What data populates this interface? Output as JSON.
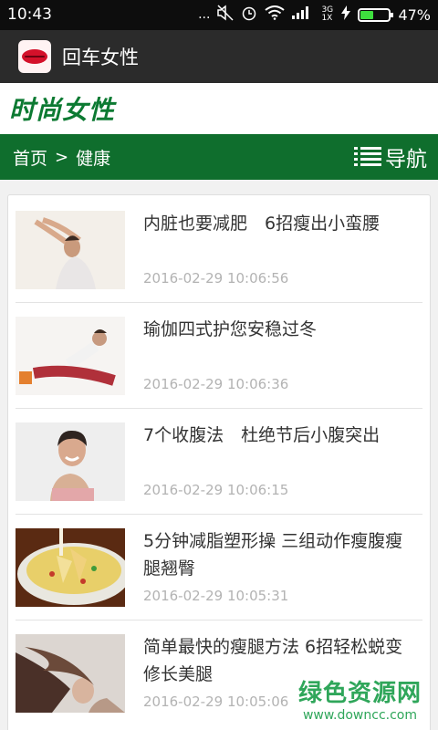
{
  "status_bar": {
    "time": "10:43",
    "dots": "...",
    "network": "3G 1X",
    "battery_percent": "47%",
    "battery_level": 0.47,
    "icons": [
      "mute-icon",
      "alarm-icon",
      "wifi-icon",
      "signal-icon",
      "charging-icon",
      "battery-icon"
    ]
  },
  "app_bar": {
    "title": "回车女性",
    "logo_icon": "lips-icon"
  },
  "site": {
    "title": "时尚女性"
  },
  "nav": {
    "crumb_home": "首页",
    "crumb_sep": ">",
    "crumb_current": "健康",
    "menu_label": "导航",
    "menu_icon": "list-icon"
  },
  "articles": [
    {
      "title": "内脏也要减肥　6招瘦出小蛮腰",
      "date": "2016-02-29 10:06:56"
    },
    {
      "title": "瑜伽四式护您安稳过冬",
      "date": "2016-02-29 10:06:36"
    },
    {
      "title": "7个收腹法　杜绝节后小腹突出",
      "date": "2016-02-29 10:06:15"
    },
    {
      "title": "5分钟减脂塑形操 三组动作瘦腹瘦腿翘臀",
      "date": "2016-02-29 10:05:31"
    },
    {
      "title": "简单最快的瘦腿方法 6招轻松蜕变修长美腿",
      "date": "2016-02-29 10:05:06"
    }
  ],
  "watermark": {
    "name": "绿色资源网",
    "url": "www.downcc.com"
  },
  "colors": {
    "accent_green": "#0f6e2d",
    "title_green": "#0c7a32",
    "app_bar": "#2b2b2b"
  }
}
